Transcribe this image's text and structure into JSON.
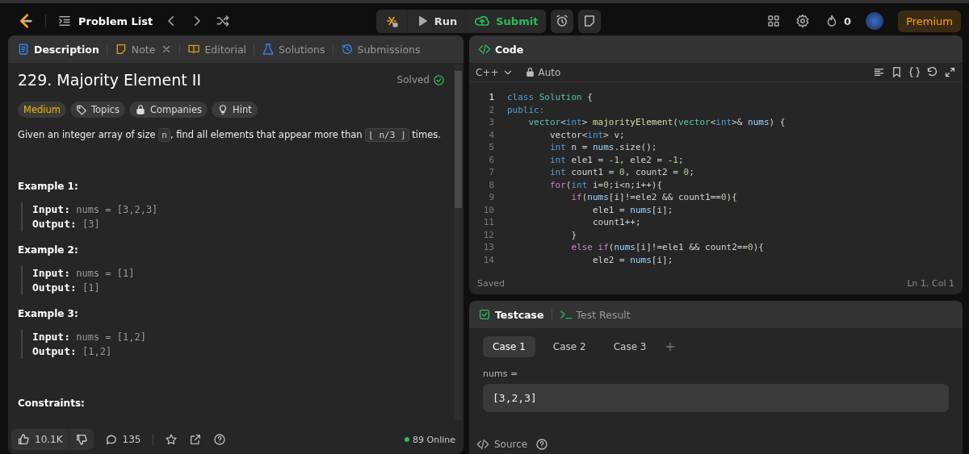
{
  "topbar": {
    "problem_list": "Problem List",
    "run": "Run",
    "submit": "Submit",
    "streak": "0",
    "premium": "Premium"
  },
  "description_tabs": [
    {
      "label": "Description",
      "selected": true,
      "closable": false
    },
    {
      "label": "Note",
      "selected": false,
      "closable": true
    },
    {
      "label": "Editorial",
      "selected": false,
      "closable": false
    },
    {
      "label": "Solutions",
      "selected": false,
      "closable": false
    },
    {
      "label": "Submissions",
      "selected": false,
      "closable": false
    }
  ],
  "problem": {
    "title": "229. Majority Element II",
    "status": "Solved",
    "difficulty": "Medium",
    "tags": [
      "Topics",
      "Companies",
      "Hint"
    ],
    "statement": [
      {
        "kind": "text",
        "text": "Given an integer array of size "
      },
      {
        "kind": "code",
        "text": "n"
      },
      {
        "kind": "text",
        "text": ", find all elements that appear more than "
      },
      {
        "kind": "code",
        "text": "⌊ n/3 ⌋"
      },
      {
        "kind": "text",
        "text": " times."
      }
    ],
    "examples": [
      {
        "heading": "Example 1:",
        "lines": [
          "**Input:** nums = [3,2,3]",
          "**Output:** [3]"
        ]
      },
      {
        "heading": "Example 2:",
        "lines": [
          "**Input:** nums = [1]",
          "**Output:** [1]"
        ]
      },
      {
        "heading": "Example 3:",
        "lines": [
          "**Input:** nums = [1,2]",
          "**Output:** [1,2]"
        ]
      }
    ],
    "constraints_heading": "Constraints:"
  },
  "description_footer": {
    "likes": "10.1K",
    "comments": "135",
    "online": "89 Online"
  },
  "code_panel": {
    "title": "Code",
    "language": "C++",
    "mode": "Auto",
    "lines": [
      {
        "number": "1",
        "active": true,
        "tokens": [
          {
            "kind": "kw",
            "text": "class"
          },
          {
            "kind": "type",
            "text": " Solution"
          },
          {
            "kind": "p",
            "text": " {"
          }
        ]
      },
      {
        "number": "2",
        "active": false,
        "tokens": [
          {
            "kind": "kw",
            "text": "public:"
          }
        ]
      },
      {
        "number": "3",
        "active": false,
        "tokens": [
          {
            "kind": "type",
            "text": "    vector"
          },
          {
            "kind": "p",
            "text": "<"
          },
          {
            "kind": "kw",
            "text": "int"
          },
          {
            "kind": "p",
            "text": "> "
          },
          {
            "kind": "fn",
            "text": "majorityElement"
          },
          {
            "kind": "p",
            "text": "("
          },
          {
            "kind": "type",
            "text": "vector"
          },
          {
            "kind": "p",
            "text": "<"
          },
          {
            "kind": "kw",
            "text": "int"
          },
          {
            "kind": "p",
            "text": ">& "
          },
          {
            "kind": "var",
            "text": "nums"
          },
          {
            "kind": "p",
            "text": ") {"
          }
        ]
      },
      {
        "number": "4",
        "active": false,
        "tokens": [
          {
            "kind": "p",
            "text": "        vector<"
          },
          {
            "kind": "kw",
            "text": "int"
          },
          {
            "kind": "p",
            "text": "> v;"
          }
        ]
      },
      {
        "number": "5",
        "active": false,
        "tokens": [
          {
            "kind": "kw",
            "text": "        int"
          },
          {
            "kind": "p",
            "text": " n = "
          },
          {
            "kind": "var",
            "text": "nums"
          },
          {
            "kind": "p",
            "text": ".size();"
          }
        ]
      },
      {
        "number": "6",
        "active": false,
        "tokens": [
          {
            "kind": "kw",
            "text": "        int"
          },
          {
            "kind": "p",
            "text": " ele1 = -"
          },
          {
            "kind": "num",
            "text": "1"
          },
          {
            "kind": "p",
            "text": ", ele2 = -"
          },
          {
            "kind": "num",
            "text": "1"
          },
          {
            "kind": "p",
            "text": ";"
          }
        ]
      },
      {
        "number": "7",
        "active": false,
        "tokens": [
          {
            "kind": "kw",
            "text": "        int"
          },
          {
            "kind": "p",
            "text": " count1 = "
          },
          {
            "kind": "num",
            "text": "0"
          },
          {
            "kind": "p",
            "text": ", count2 = "
          },
          {
            "kind": "num",
            "text": "0"
          },
          {
            "kind": "p",
            "text": ";"
          }
        ]
      },
      {
        "number": "8",
        "active": false,
        "tokens": [
          {
            "kind": "ctl",
            "text": "        for"
          },
          {
            "kind": "p",
            "text": "("
          },
          {
            "kind": "kw",
            "text": "int"
          },
          {
            "kind": "p",
            "text": " i="
          },
          {
            "kind": "num",
            "text": "0"
          },
          {
            "kind": "p",
            "text": ";i<n;i++){"
          }
        ]
      },
      {
        "number": "9",
        "active": false,
        "tokens": [
          {
            "kind": "ctl",
            "text": "            if"
          },
          {
            "kind": "p",
            "text": "("
          },
          {
            "kind": "var",
            "text": "nums"
          },
          {
            "kind": "p",
            "text": "[i]!=ele2 && count1=="
          },
          {
            "kind": "num",
            "text": "0"
          },
          {
            "kind": "p",
            "text": "){"
          }
        ]
      },
      {
        "number": "10",
        "active": false,
        "tokens": [
          {
            "kind": "p",
            "text": "                ele1 = "
          },
          {
            "kind": "var",
            "text": "nums"
          },
          {
            "kind": "p",
            "text": "[i];"
          }
        ]
      },
      {
        "number": "11",
        "active": false,
        "tokens": [
          {
            "kind": "p",
            "text": "                count1++;"
          }
        ]
      },
      {
        "number": "12",
        "active": false,
        "tokens": [
          {
            "kind": "p",
            "text": "            }"
          }
        ]
      },
      {
        "number": "13",
        "active": false,
        "tokens": [
          {
            "kind": "ctl",
            "text": "            else if"
          },
          {
            "kind": "p",
            "text": "("
          },
          {
            "kind": "var",
            "text": "nums"
          },
          {
            "kind": "p",
            "text": "[i]!=ele1 && count2=="
          },
          {
            "kind": "num",
            "text": "0"
          },
          {
            "kind": "p",
            "text": "){"
          }
        ]
      },
      {
        "number": "14",
        "active": false,
        "tokens": [
          {
            "kind": "p",
            "text": "                ele2 = "
          },
          {
            "kind": "var",
            "text": "nums"
          },
          {
            "kind": "p",
            "text": "[i];"
          }
        ]
      }
    ],
    "status": "Saved",
    "cursor": "Ln 1, Col 1"
  },
  "testcase_panel": {
    "tabs": [
      {
        "label": "Testcase",
        "selected": true
      },
      {
        "label": "Test Result",
        "selected": false
      }
    ],
    "cases": [
      {
        "label": "Case 1",
        "selected": true
      },
      {
        "label": "Case 2",
        "selected": false
      },
      {
        "label": "Case 3",
        "selected": false
      }
    ],
    "param_label": "nums =",
    "param_value": "[3,2,3]",
    "source": "Source"
  }
}
